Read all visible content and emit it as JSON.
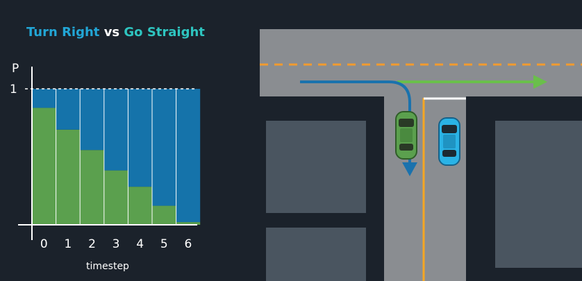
{
  "title": {
    "part1": "Turn Right",
    "part2": " vs ",
    "part3": "Go Straight"
  },
  "colors": {
    "background": "#1b222b",
    "turn_right": "#1573aa",
    "go_straight": "#5ba04e",
    "title_blue": "#22a6d6",
    "title_teal": "#2ec5c0",
    "road": "#8a8d91",
    "block": "#4a5560",
    "lane_dash": "#f29b2e",
    "green_arrow": "#6abf4b",
    "blue_arrow": "#1a72ad"
  },
  "chart_data": {
    "type": "bar",
    "stacked": true,
    "categories": [
      "0",
      "1",
      "2",
      "3",
      "4",
      "5",
      "6"
    ],
    "series": [
      {
        "name": "Go Straight",
        "values": [
          0.86,
          0.7,
          0.55,
          0.4,
          0.28,
          0.14,
          0.02
        ]
      },
      {
        "name": "Turn Right",
        "values": [
          0.14,
          0.3,
          0.45,
          0.6,
          0.72,
          0.86,
          0.98
        ]
      }
    ],
    "ylabel": "P",
    "xlabel": "timestep",
    "yticks": [
      "1"
    ],
    "ylim": [
      0,
      1
    ]
  },
  "scene": {
    "icons": [
      "road-map",
      "green-car",
      "blue-car",
      "green-arrow-straight",
      "blue-arrow-turn-right"
    ]
  }
}
